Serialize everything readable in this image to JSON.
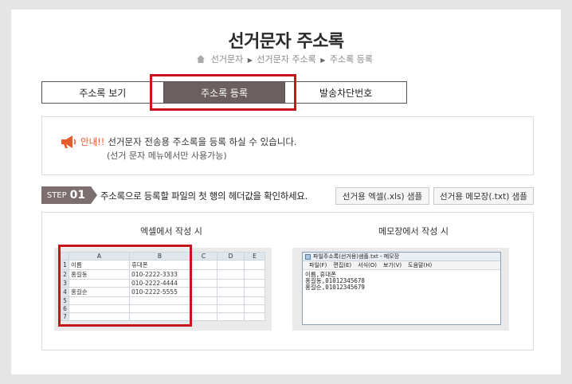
{
  "header": {
    "title": "선거문자 주소록",
    "breadcrumb": [
      "선거문자",
      "선거문자 주소록",
      "주소록 등록"
    ]
  },
  "tabs": [
    {
      "label": "주소록 보기",
      "active": false
    },
    {
      "label": "주소록 등록",
      "active": true
    },
    {
      "label": "발송차단번호",
      "active": false
    }
  ],
  "notice": {
    "warn": "안내!!",
    "line1": "선거문자 전송용 주소록을 등록 하실 수 있습니다.",
    "line2": "(선거 문자 메뉴에서만 사용가능)"
  },
  "step": {
    "label": "STEP",
    "number": "01",
    "text": "주소록으로 등록할 파일의 첫 행의 헤더값을 확인하세요.",
    "buttons": {
      "excel_sample": "선거용 엑셀(.xls) 샘플",
      "notepad_sample": "선거용 메모장(.txt) 샘플"
    }
  },
  "samples": {
    "excel_title": "엑셀에서 작성 시",
    "notepad_title": "메모장에서 작성 시",
    "excel": {
      "columns": [
        "A",
        "B",
        "C",
        "D",
        "E"
      ],
      "rows": [
        {
          "n": "1",
          "a": "이름",
          "b": "휴대폰"
        },
        {
          "n": "2",
          "a": "홍길동",
          "b": "010-2222-3333"
        },
        {
          "n": "3",
          "a": "",
          "b": "010-2222-4444"
        },
        {
          "n": "4",
          "a": "홍길순",
          "b": "010-2222-5555"
        },
        {
          "n": "5",
          "a": "",
          "b": ""
        },
        {
          "n": "6",
          "a": "",
          "b": ""
        },
        {
          "n": "7",
          "a": "",
          "b": ""
        }
      ]
    },
    "notepad": {
      "title": "파일주소록(선거용)샘플.txt - 메모장",
      "menu": [
        "파일(F)",
        "편집(E)",
        "서식(O)",
        "보기(V)",
        "도움말(H)"
      ],
      "lines": [
        "이름,휴대폰",
        "홍길동,01012345678",
        "홍길순,01012345679"
      ]
    }
  },
  "colors": {
    "accent_red": "#c8151b",
    "tab_active": "#6c5f5f",
    "warn_orange": "#e85a2a"
  }
}
